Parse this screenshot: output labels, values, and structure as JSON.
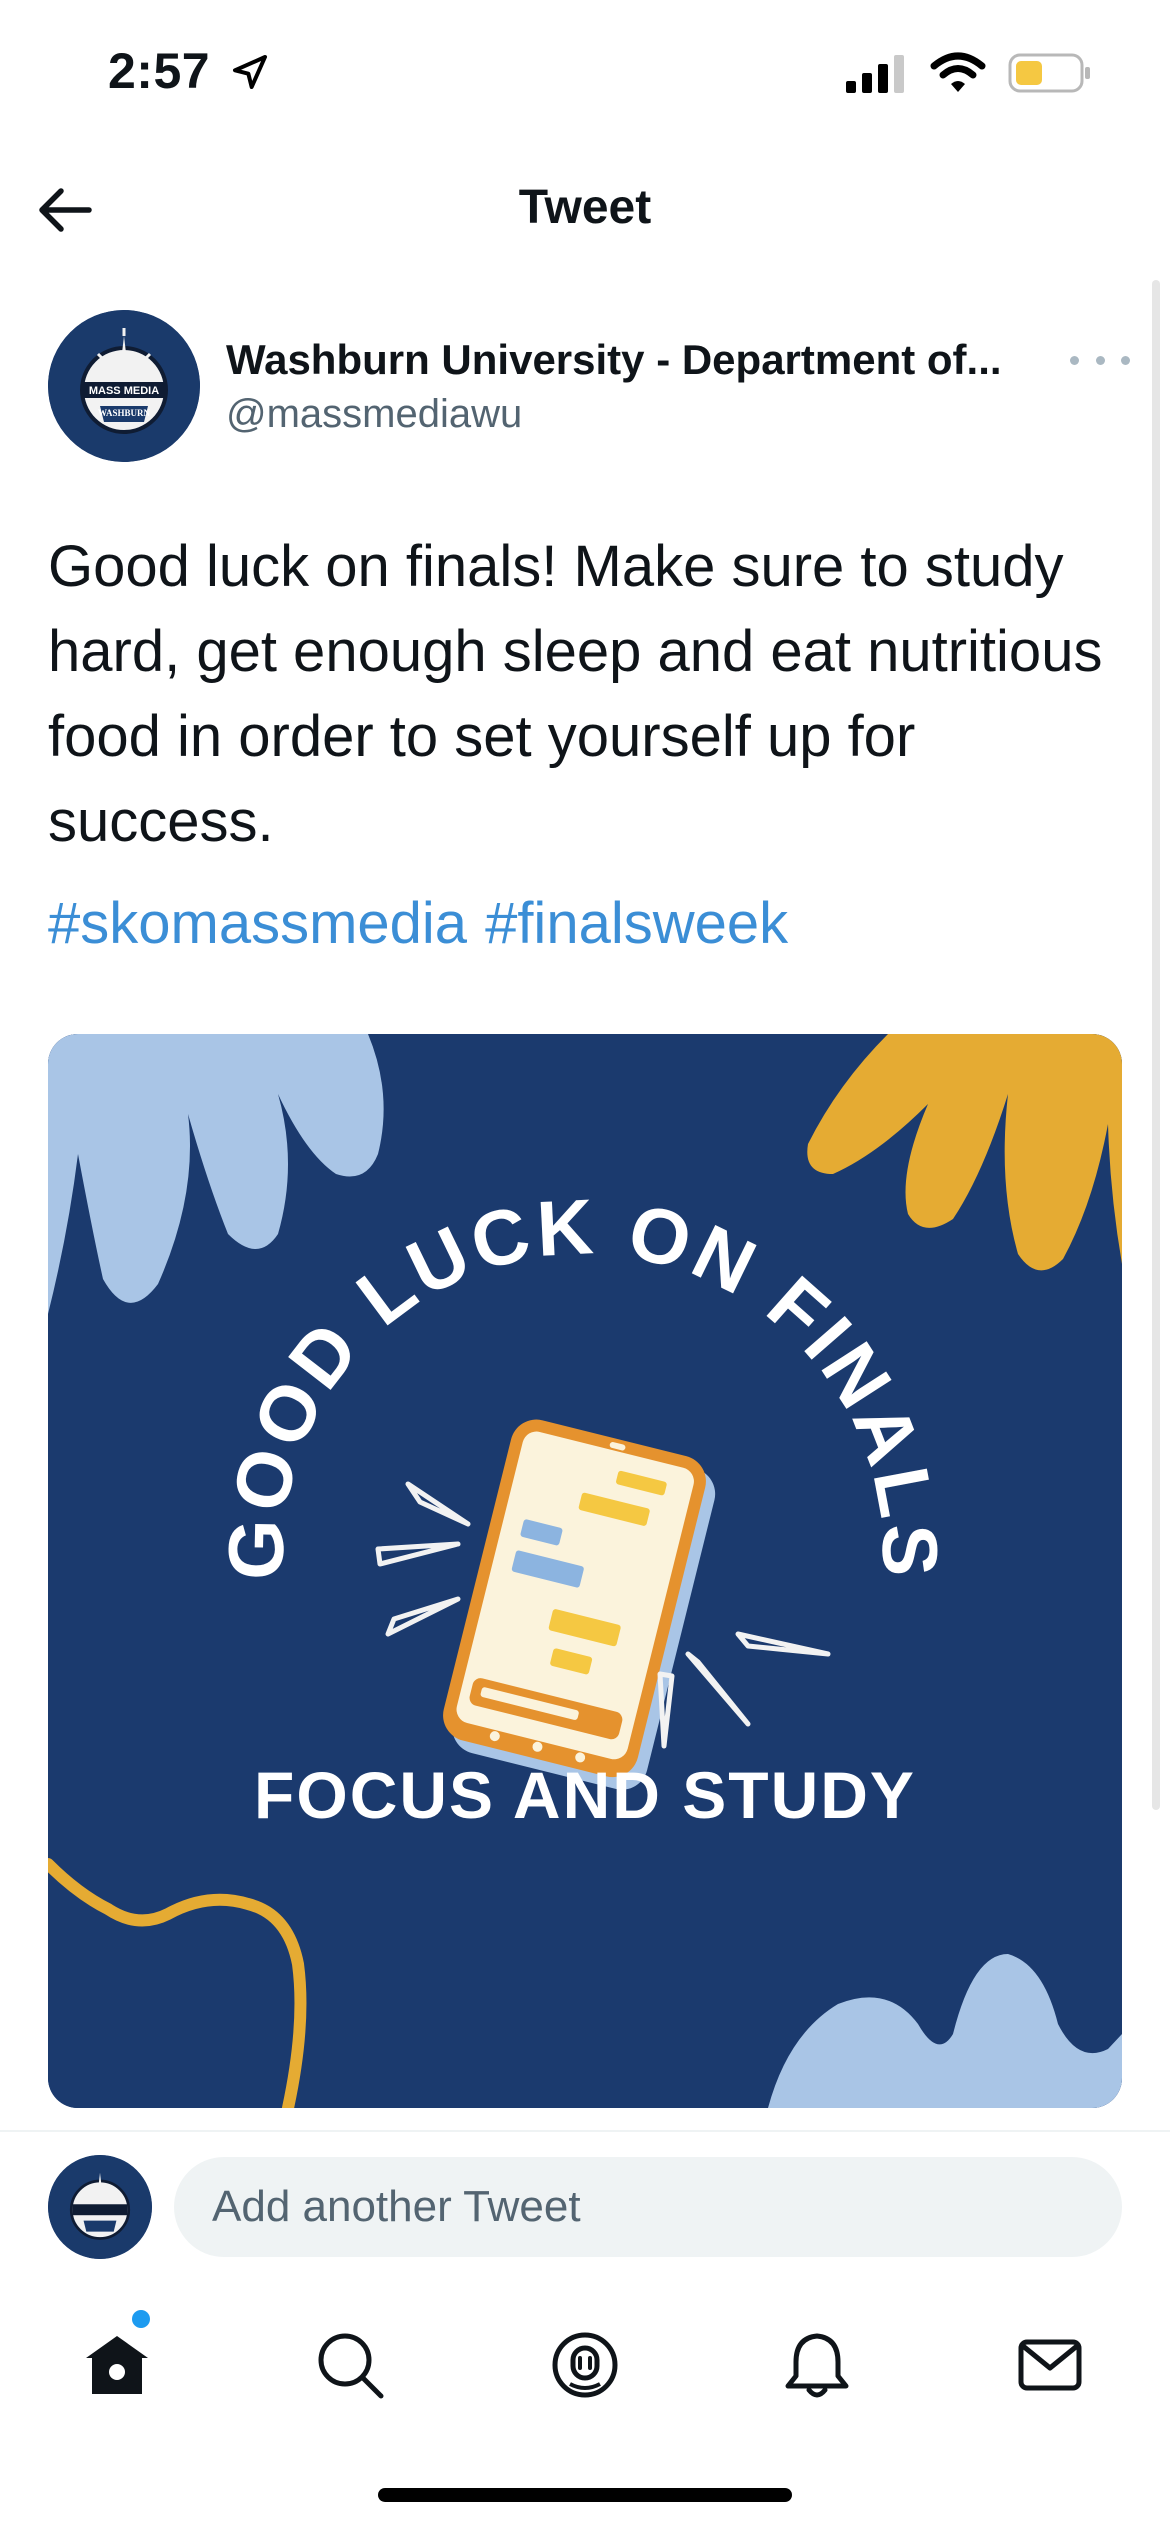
{
  "status_bar": {
    "time": "2:57"
  },
  "header": {
    "title": "Tweet"
  },
  "tweet": {
    "author_name": "Washburn University - Department of...",
    "author_handle": "@massmediawu",
    "text": "Good luck on finals! Make sure to study hard, get enough sleep and eat nutritious food in order to set yourself up for success.",
    "hashtags": [
      "#skomassmedia",
      "#finalsweek"
    ],
    "media": {
      "arc_text": "GOOD LUCK ON FINALS",
      "caption": "FOCUS AND STUDY"
    }
  },
  "reply": {
    "placeholder": "Add another Tweet"
  },
  "avatar_logo": {
    "line1": "MASS MEDIA",
    "line2": "WASHBURN"
  },
  "colors": {
    "accent": "#1d9bf0",
    "hashtag": "#3b8ed6",
    "media_bg": "#1b3a6e",
    "light_blue": "#a9c5e6",
    "gold": "#e5ab33"
  }
}
